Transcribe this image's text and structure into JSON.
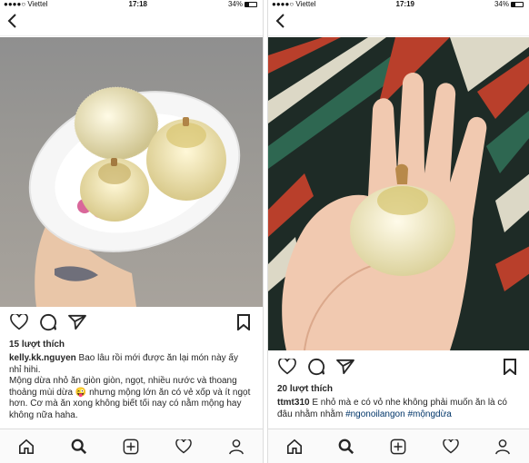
{
  "left": {
    "status": {
      "carrier": "●●●●○ Viettel",
      "time": "17:18",
      "battery": "34%"
    },
    "likes": "15 lượt thích",
    "caption_user": "kelly.kk.nguyen",
    "caption_text": "Bao lâu rồi mới được ăn lại món này ấy nhỉ hihi.",
    "caption_body_1": "Mộng dừa nhỏ ăn giòn giòn, ngọt, nhiều nước và thoang thoảng mùi dừa",
    "caption_emoji": "😜",
    "caption_body_2": "nhưng mộng lớn ăn có vẻ xốp và ít ngọt hơn. Cơ mà ăn xong không biết tối nay có nằm mộng hay không nữa haha."
  },
  "right": {
    "status": {
      "carrier": "●●●●○ Viettel",
      "time": "17:19",
      "battery": "34%"
    },
    "likes": "20 lượt thích",
    "caption_user": "ttmt310",
    "caption_text": "E nhỏ mà e có vỏ nhe không phải muốn ăn là có đâu nhằm nhằm",
    "tag_1": "#ngonoilangon",
    "tag_2": "#mộngdừa"
  },
  "icons": {
    "back": "chevron-left-icon",
    "like": "heart-icon",
    "comment": "comment-bubble-icon",
    "share": "paper-plane-icon",
    "save": "bookmark-icon",
    "tabs": [
      "home-icon",
      "search-icon",
      "add-post-icon",
      "activity-heart-icon",
      "profile-icon"
    ]
  },
  "colors": {
    "hashtag": "#003569",
    "text": "#262626"
  }
}
